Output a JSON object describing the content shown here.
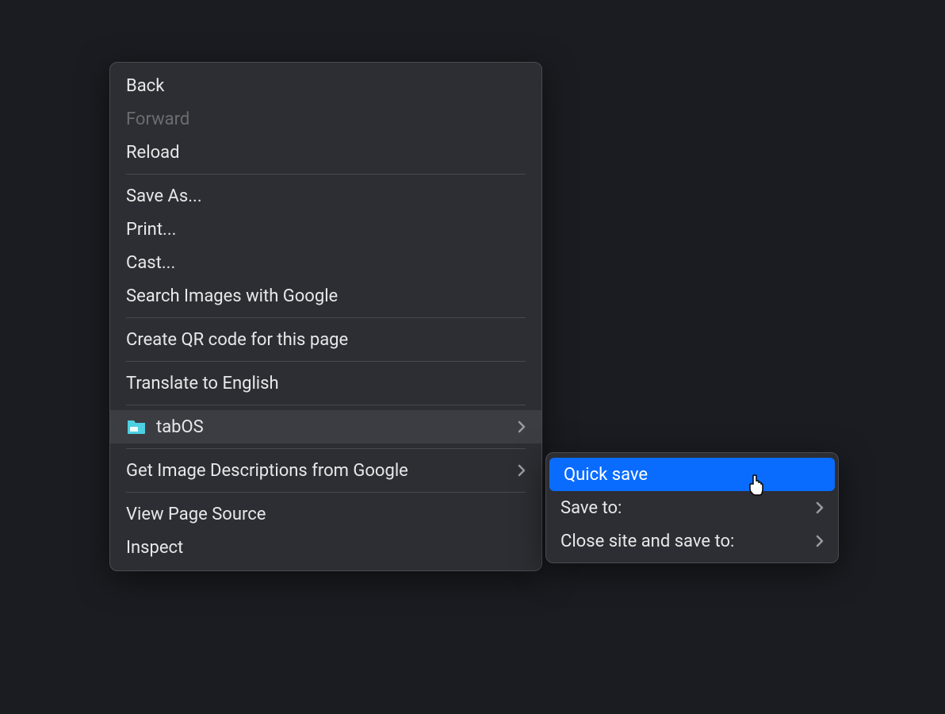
{
  "contextMenu": {
    "items": [
      {
        "label": "Back",
        "disabled": false,
        "hasSubmenu": false
      },
      {
        "label": "Forward",
        "disabled": true,
        "hasSubmenu": false
      },
      {
        "label": "Reload",
        "disabled": false,
        "hasSubmenu": false
      },
      {
        "separator": true
      },
      {
        "label": "Save As...",
        "disabled": false,
        "hasSubmenu": false
      },
      {
        "label": "Print...",
        "disabled": false,
        "hasSubmenu": false
      },
      {
        "label": "Cast...",
        "disabled": false,
        "hasSubmenu": false
      },
      {
        "label": "Search Images with Google",
        "disabled": false,
        "hasSubmenu": false
      },
      {
        "separator": true
      },
      {
        "label": "Create QR code for this page",
        "disabled": false,
        "hasSubmenu": false
      },
      {
        "separator": true
      },
      {
        "label": "Translate to English",
        "disabled": false,
        "hasSubmenu": false
      },
      {
        "separator": true
      },
      {
        "label": "tabOS",
        "disabled": false,
        "hasSubmenu": true,
        "icon": "folder",
        "highlighted": true
      },
      {
        "separator": true
      },
      {
        "label": "Get Image Descriptions from Google",
        "disabled": false,
        "hasSubmenu": true
      },
      {
        "separator": true
      },
      {
        "label": "View Page Source",
        "disabled": false,
        "hasSubmenu": false
      },
      {
        "label": "Inspect",
        "disabled": false,
        "hasSubmenu": false
      }
    ]
  },
  "submenu": {
    "items": [
      {
        "label": "Quick save",
        "hasSubmenu": false,
        "selected": true
      },
      {
        "label": "Save to:",
        "hasSubmenu": true,
        "selected": false
      },
      {
        "label": "Close site and save to:",
        "hasSubmenu": true,
        "selected": false
      }
    ]
  },
  "colors": {
    "folderIcon": "#4dd0e1",
    "selectionBlue": "#0a6cff"
  }
}
